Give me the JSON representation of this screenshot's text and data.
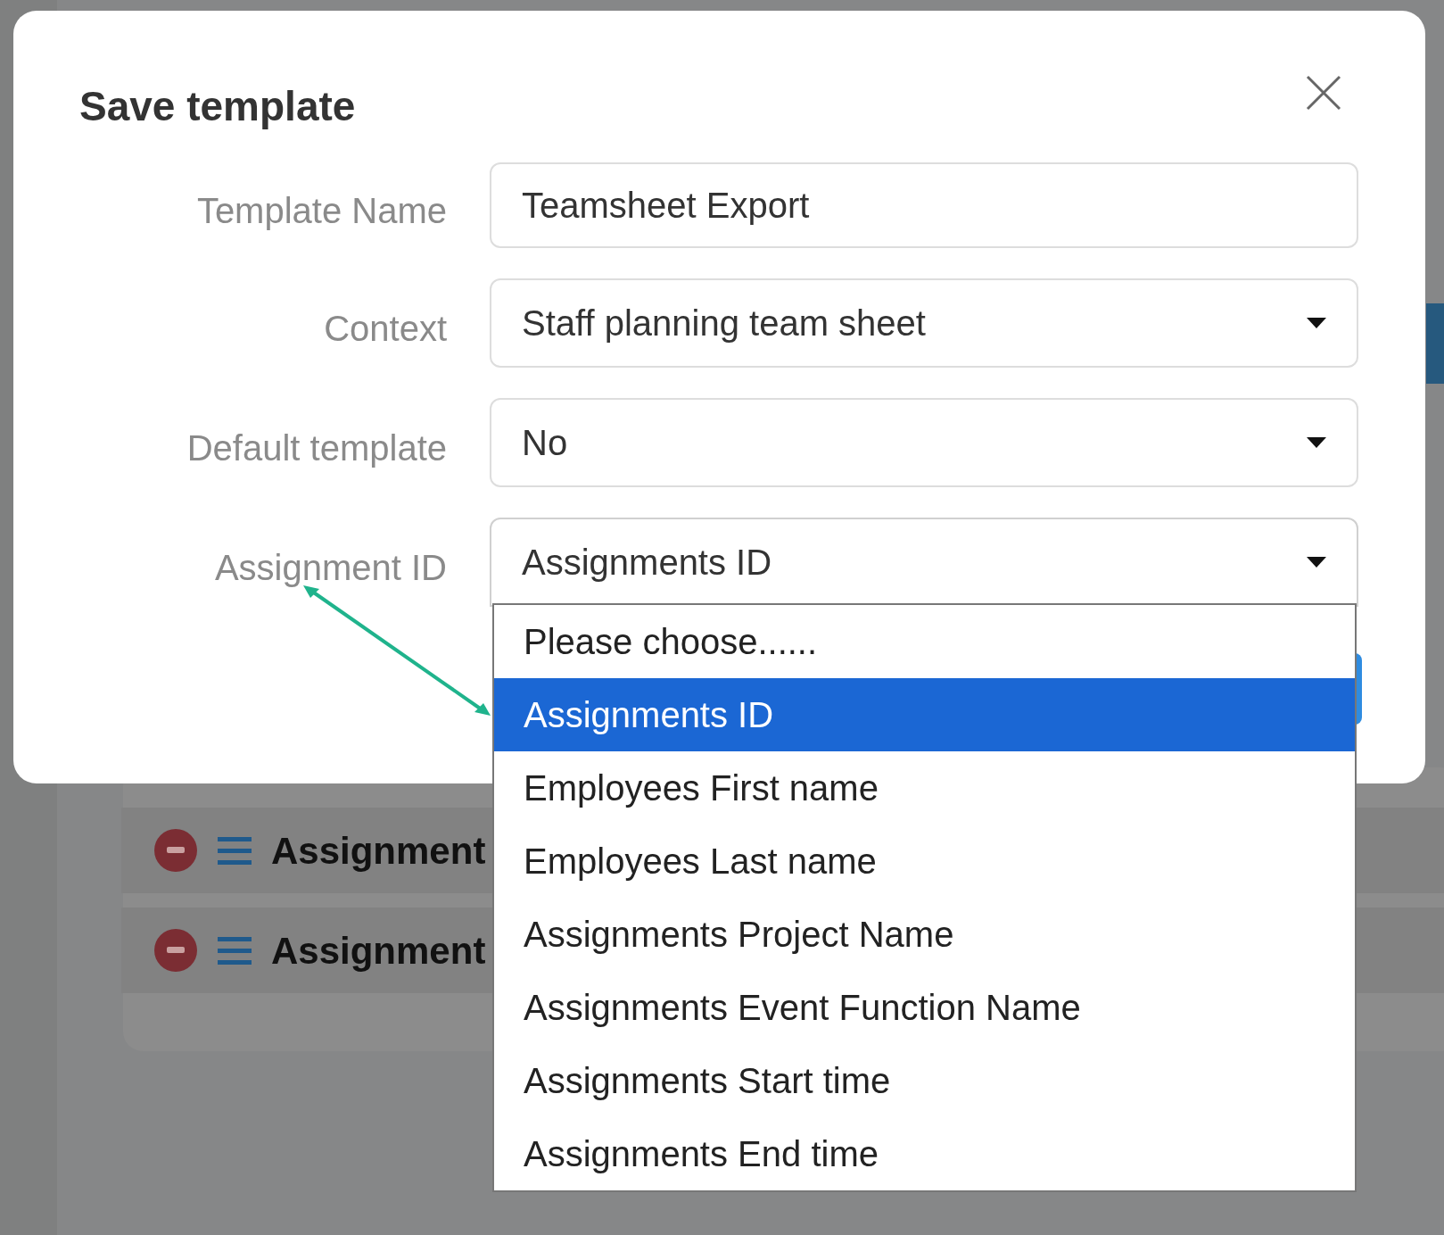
{
  "background": {
    "rows": [
      {
        "label": "Assignment"
      },
      {
        "label": "Assignment"
      }
    ]
  },
  "dialog": {
    "title": "Save template",
    "fields": [
      {
        "label": "Template Name",
        "kind": "text",
        "value": "Teamsheet Export"
      },
      {
        "label": "Context",
        "kind": "select",
        "value": "Staff planning team sheet"
      },
      {
        "label": "Default template",
        "kind": "select",
        "value": "No"
      },
      {
        "label": "Assignment ID",
        "kind": "select",
        "value": "Assignments ID",
        "expanded": true
      }
    ]
  },
  "dropdown": {
    "options": [
      {
        "label": "Please choose......",
        "selected": false
      },
      {
        "label": "Assignments ID",
        "selected": true
      },
      {
        "label": "Employees First name",
        "selected": false
      },
      {
        "label": "Employees Last name",
        "selected": false
      },
      {
        "label": "Assignments Project Name",
        "selected": false
      },
      {
        "label": "Assignments Event Function Name",
        "selected": false
      },
      {
        "label": "Assignments Start time",
        "selected": false
      },
      {
        "label": "Assignments End time",
        "selected": false
      }
    ]
  }
}
